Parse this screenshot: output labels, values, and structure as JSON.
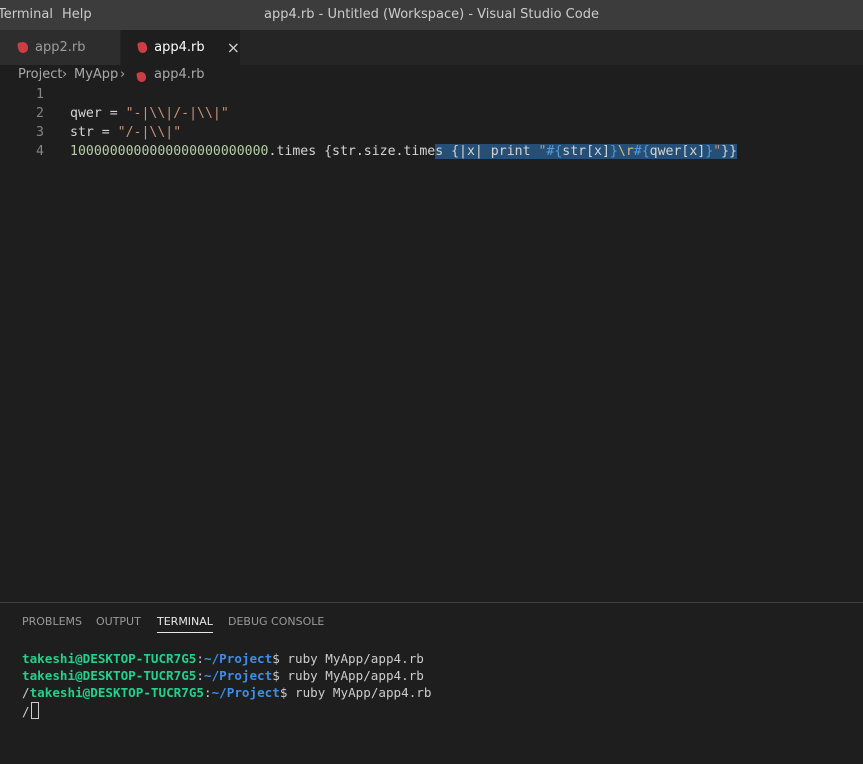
{
  "titlebar": {
    "menu": [
      "Terminal",
      "Help"
    ],
    "title": "app4.rb - Untitled (Workspace) - Visual Studio Code"
  },
  "tabs": [
    {
      "label": "app2.rb",
      "active": false
    },
    {
      "label": "app4.rb",
      "active": true
    }
  ],
  "close_icon": "×",
  "breadcrumb": [
    "Project",
    "MyApp",
    "app4.rb"
  ],
  "editor": {
    "line_numbers": [
      "1",
      "2",
      "3",
      "4"
    ],
    "line2": {
      "pre": "qwer = ",
      "str": "\"-|\\\\|/-|\\\\|\""
    },
    "line3": {
      "pre": "str = ",
      "str": "\"/-|\\\\|\""
    },
    "line4": {
      "num": "1000000000000000000000000",
      "mid": ".times {str.size.time",
      "sel_a": "s {|x| print ",
      "q1": "\"",
      "i1": "#{",
      "v1": "str[x]",
      "i2": "}",
      "esc": "\\r",
      "i3": "#{",
      "v2": "qwer[x]",
      "i4": "}",
      "q2": "\"",
      "end": "}}"
    }
  },
  "panel": {
    "tabs": [
      "PROBLEMS",
      "OUTPUT",
      "TERMINAL",
      "DEBUG CONSOLE"
    ],
    "active_tab": "TERMINAL"
  },
  "terminal": {
    "lines": [
      {
        "prefix": "",
        "user": "takeshi@DESKTOP-TUCR7G5",
        "colon": ":",
        "path": "~/Project",
        "cmd": "$ ruby MyApp/app4.rb"
      },
      {
        "prefix": "",
        "user": "takeshi@DESKTOP-TUCR7G5",
        "colon": ":",
        "path": "~/Project",
        "cmd": "$ ruby MyApp/app4.rb"
      },
      {
        "prefix": "/",
        "user": "takeshi@DESKTOP-TUCR7G5",
        "colon": ":",
        "path": "~/Project",
        "cmd": "$ ruby MyApp/app4.rb"
      }
    ],
    "current": "/"
  },
  "colors": {
    "titlebar": "#3c3c3c",
    "editor_bg": "#1e1e1e",
    "selection": "#264f78",
    "string": "#ce9178",
    "number": "#b5cea8",
    "term_user": "#23d18b",
    "term_path": "#3b8eea"
  }
}
